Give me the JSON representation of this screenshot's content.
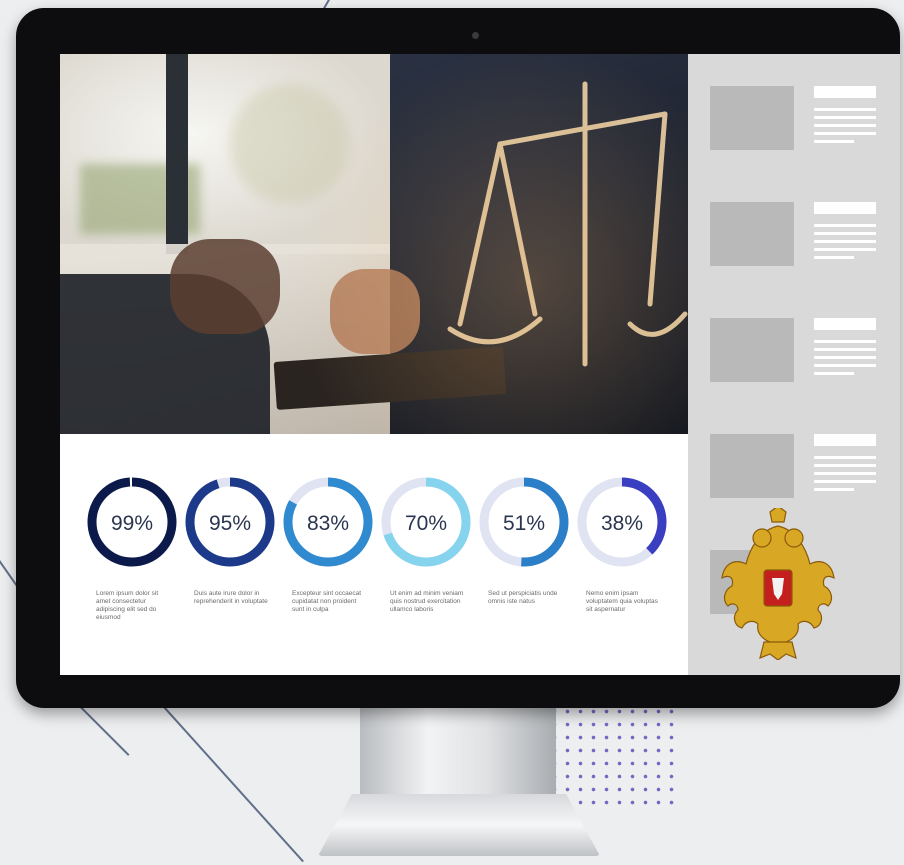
{
  "screen": {
    "stats": [
      {
        "percent_label": "99%",
        "value": 0.99,
        "color": "#0b1a4a",
        "track": "#ffffff",
        "caption": "Lorem ipsum dolor sit amet consectetur adipiscing elit sed do eiusmod"
      },
      {
        "percent_label": "95%",
        "value": 0.95,
        "color": "#1d3a8a",
        "track": "#dfe3f2",
        "caption": "Duis aute irure dolor in reprehenderit in voluptate"
      },
      {
        "percent_label": "83%",
        "value": 0.83,
        "color": "#2f8ad0",
        "track": "#dfe3f2",
        "caption": "Excepteur sint occaecat cupidatat non proident sunt in culpa"
      },
      {
        "percent_label": "70%",
        "value": 0.7,
        "color": "#86d3ee",
        "track": "#dfe3f2",
        "caption": "Ut enim ad minim veniam quis nostrud exercitation ullamco laboris"
      },
      {
        "percent_label": "51%",
        "value": 0.51,
        "color": "#2b7fc8",
        "track": "#dfe3f2",
        "caption": "Sed ut perspiciatis unde omnis iste natus"
      },
      {
        "percent_label": "38%",
        "value": 0.38,
        "color": "#3a3ec0",
        "track": "#dfe3f2",
        "caption": "Nemo enim ipsam voluptatem quia voluptas sit aspernatur"
      }
    ],
    "sidebar_cards": 5,
    "emblem": "russian-coat-of-arms-icon"
  },
  "colors": {
    "bezel": "#0d0d0f",
    "sidebar": "#d9d9d9",
    "placeholder": "#b9b9b9"
  }
}
